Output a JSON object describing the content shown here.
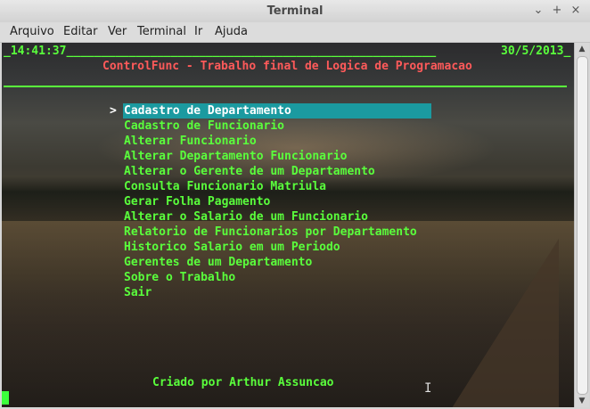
{
  "window": {
    "title": "Terminal"
  },
  "menubar": [
    "Arquivo",
    "Editar",
    "Ver",
    "Terminal",
    "Ir",
    "Ajuda"
  ],
  "terminal": {
    "header_left": "_14:41:37_____________________________________________________",
    "header_right": "30/5/2013_",
    "app_title": "ControlFunc - Trabalho final de Logica de Programacao",
    "selector": ">",
    "menu": [
      "Cadastro de Departamento",
      "Cadastro de Funcionario",
      "Alterar Funcionario",
      "Alterar Departamento Funcionario",
      "Alterar o Gerente de um Departamento",
      "Consulta Funcionario Matriula",
      "Gerar Folha Pagamento",
      "Alterar o Salario de um Funcionario",
      "Relatorio de Funcionarios por Departamento",
      "Historico Salario em um Periodo",
      "Gerentes de um Departamento",
      "Sobre o Trabalho",
      "Sair"
    ],
    "selected_index": 0,
    "footer": "Criado por Arthur Assuncao"
  },
  "colors": {
    "text": "#5aff3c",
    "title": "#ff5a5a",
    "highlight": "#1b9aa0"
  }
}
